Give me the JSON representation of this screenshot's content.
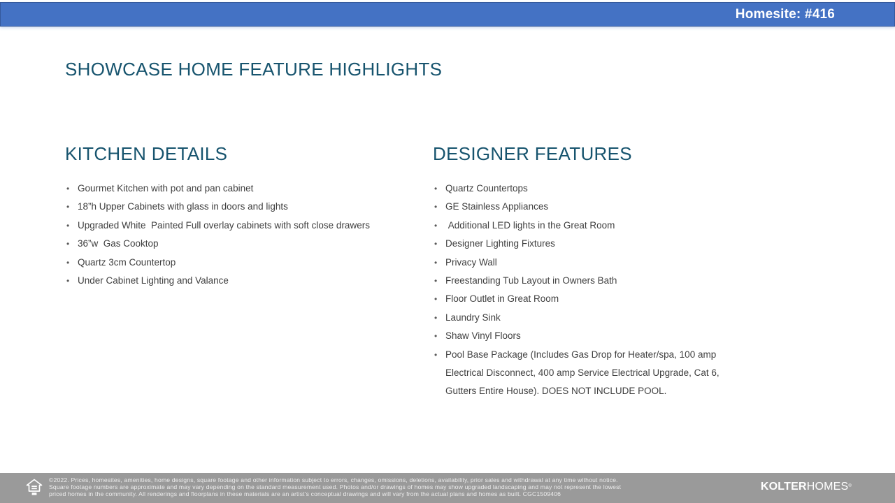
{
  "banner": {
    "homesite_label": "Homesite: #416",
    "bg_color": "#4472C4"
  },
  "page_title": "SHOWCASE HOME FEATURE HIGHLIGHTS",
  "sections": [
    {
      "heading": "KITCHEN DETAILS",
      "items": [
        "Gourmet Kitchen with pot and pan cabinet",
        "18”h Upper Cabinets with glass in doors and lights",
        "Upgraded White  Painted Full overlay cabinets with soft close drawers",
        "36”w  Gas Cooktop",
        "Quartz 3cm Countertop",
        "Under Cabinet Lighting and Valance"
      ]
    },
    {
      "heading": "DESIGNER FEATURES",
      "items": [
        "Quartz Countertops",
        "GE Stainless Appliances",
        " Additional LED lights in the Great Room",
        "Designer Lighting Fixtures",
        "Privacy Wall",
        "Freestanding Tub Layout in Owners Bath",
        "Floor Outlet in Great Room",
        "Laundry Sink",
        "Shaw Vinyl Floors",
        "Pool Base Package (Includes Gas Drop for Heater/spa, 100 amp Electrical Disconnect, 400 amp Service Electrical Upgrade, Cat 6, Gutters Entire House). DOES NOT INCLUDE POOL."
      ]
    }
  ],
  "footer": {
    "disclaimer_lines": [
      "©2022. Prices, homesites, amenities, home designs, square footage and other information subject to errors, changes, omissions, deletions, availability, prior sales and withdrawal at any time without notice.",
      "Square footage numbers are approximate and may vary depending on the standard measurement used. Photos and/or drawings of homes may show upgraded landscaping and may not represent the lowest",
      "priced homes in the community. All renderings and floorplans in these materials are an artist's conceptual drawings and will vary from the actual plans and homes as built. CGC1509406"
    ],
    "logo": {
      "bold_part": "KOLTER",
      "regular_part": "HOMES",
      "registered_mark": "®"
    },
    "equal_housing_icon": "equal-housing-opportunity-icon",
    "bg_color": "#9A9A9A"
  },
  "colors": {
    "banner_blue": "#4472C4",
    "heading_teal": "#17546E",
    "body_text": "#3F3F3F",
    "footer_gray": "#9A9A9A"
  }
}
